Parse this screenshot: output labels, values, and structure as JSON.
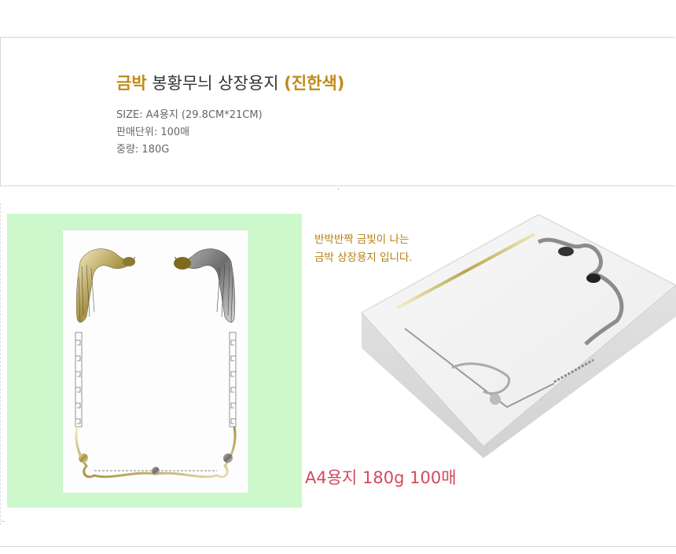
{
  "product": {
    "title_prefix": "금박",
    "title_main": " 봉황무늬 상장용지 ",
    "title_suffix": "(진한색)",
    "specs": [
      "SIZE: A4용지 (29.8CM*21CM)",
      "판매단위: 100매",
      "중량: 180G"
    ]
  },
  "caption": {
    "line1": "반박반짝 금빛이 나는",
    "line2": "금박 상장용지 입니다."
  },
  "size_label": "A4용지 180g 100매",
  "colors": {
    "gold": "#c08a18",
    "panel_green": "#ccf8cc",
    "label_red": "#d34a5c"
  }
}
